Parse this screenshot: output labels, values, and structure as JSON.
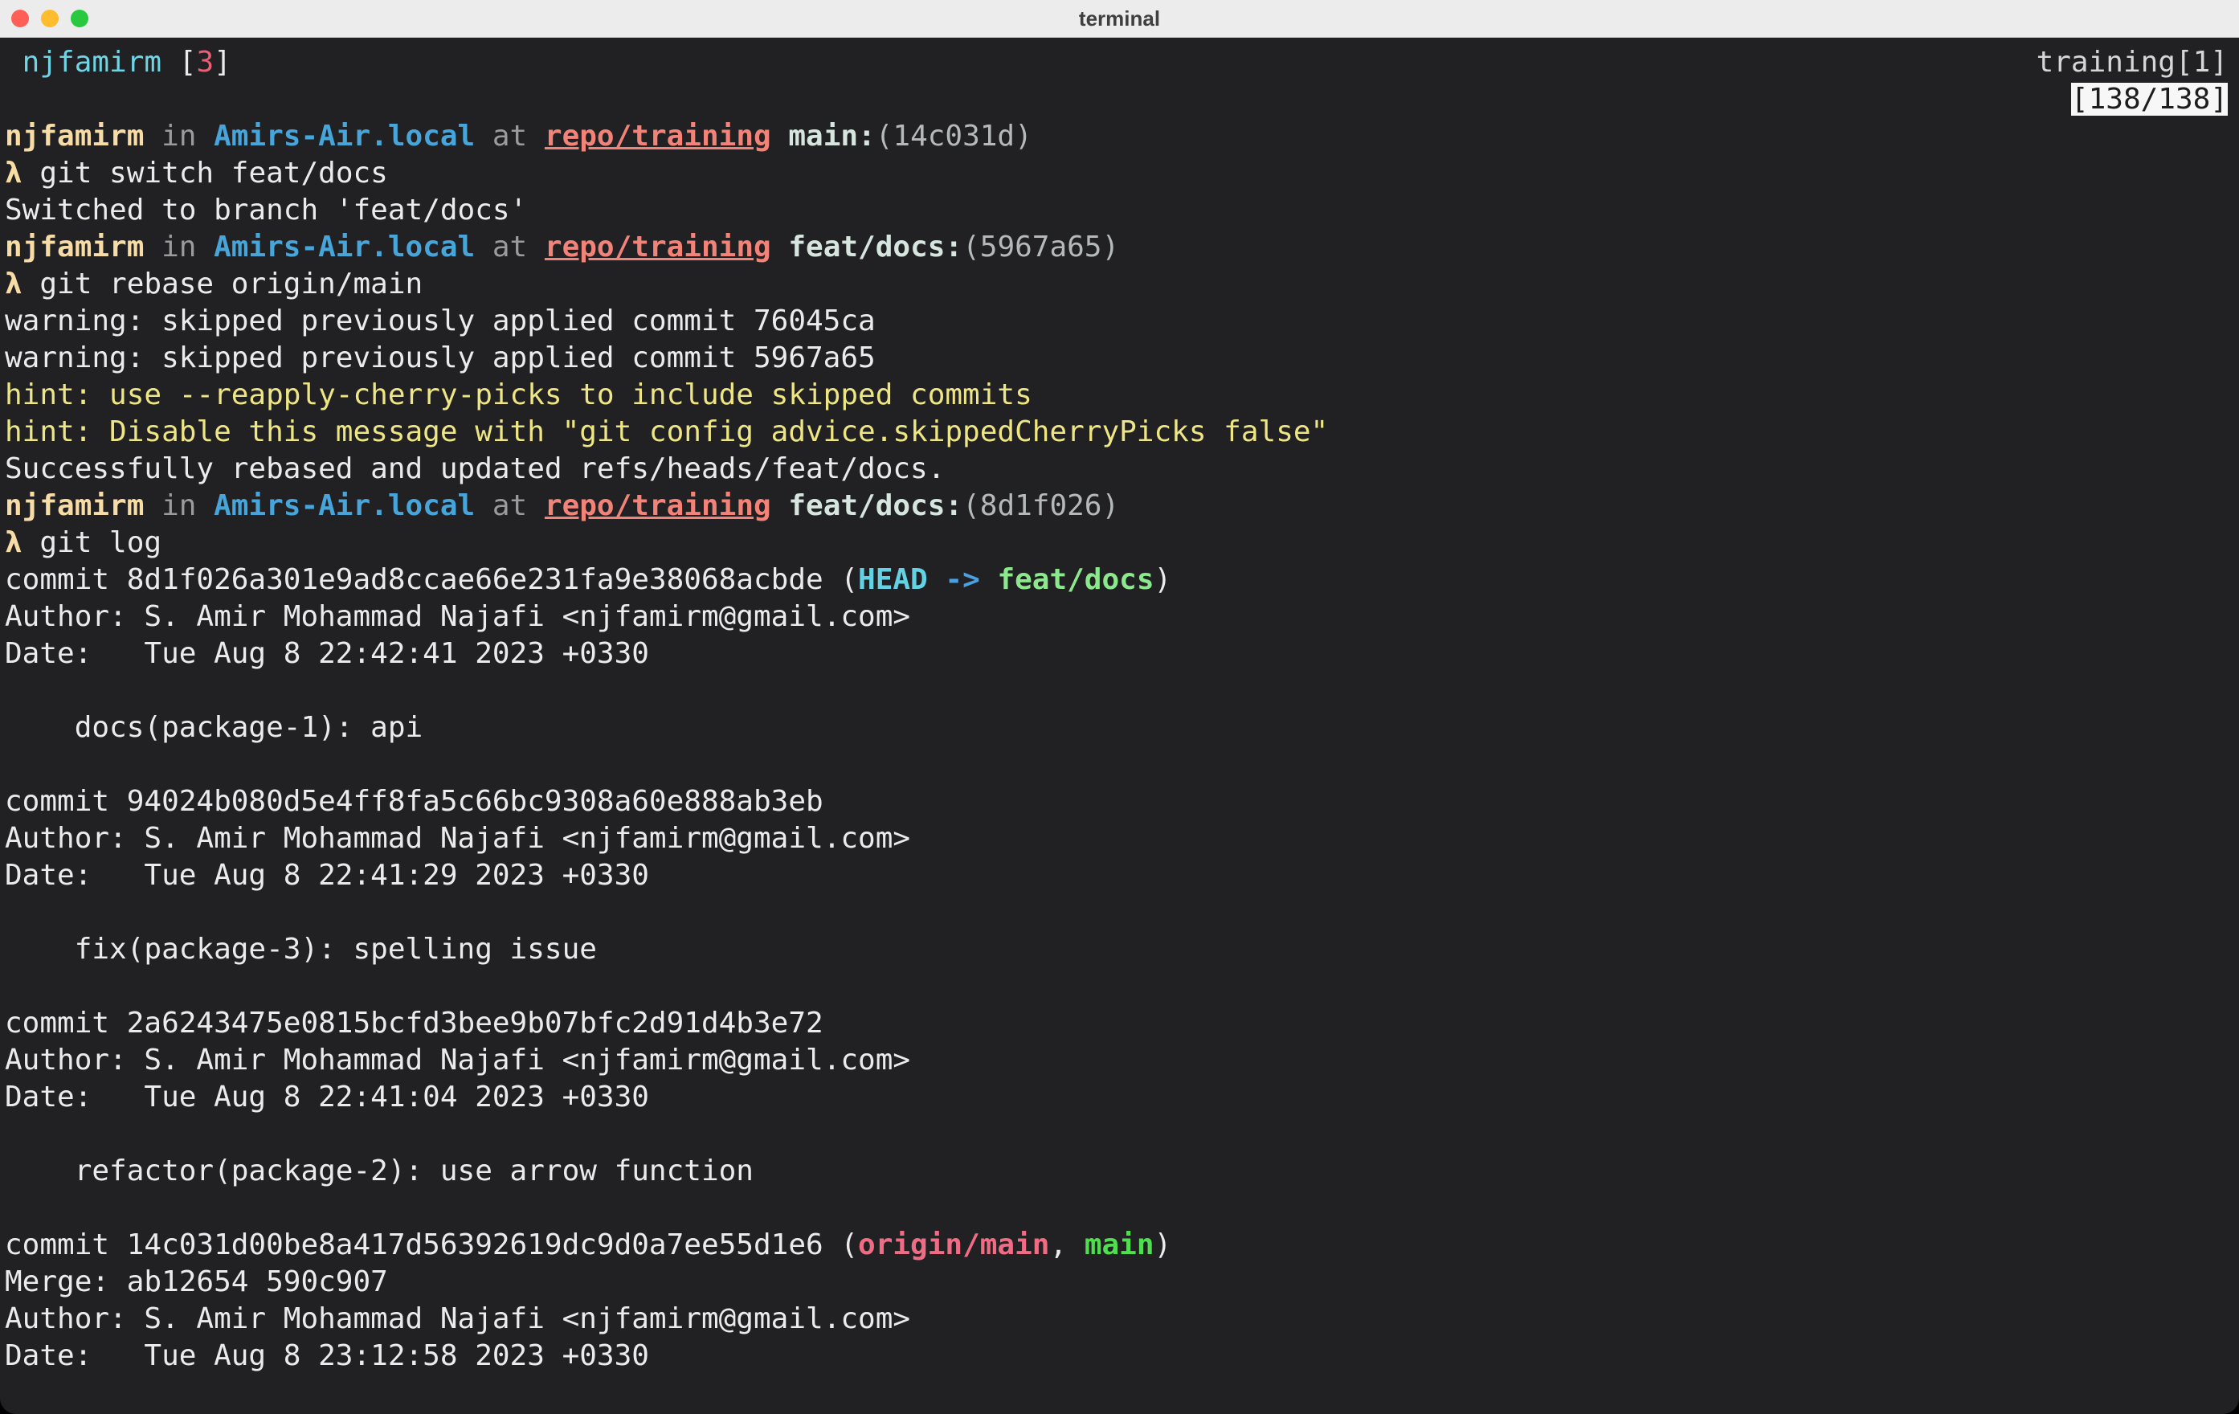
{
  "window": {
    "title": "terminal"
  },
  "colors": {
    "term_bg": "#212124",
    "titlebar_bg": "#ececec",
    "title_fg": "#3f3f3f",
    "traffic": [
      "#ff5f57",
      "#febc2e",
      "#28c840"
    ],
    "fg": "#ebebeb",
    "gray": "#9b9b9b",
    "cream": "#f7dca6",
    "blue": "#47a5da",
    "salmon": "#f28379",
    "pale": "#d6e5de",
    "hash": "#b5b9b9",
    "cyan": "#6fd4e4",
    "red": "#ea5e76",
    "ltgray": "#d6d6d6",
    "yellow": "#eee684",
    "cyan2": "#62d2e4",
    "blue2": "#4aa0e0",
    "green": "#8ce88c",
    "green2": "#50dd50",
    "pink": "#ee6d85",
    "counter_bg": "#f7f7f7",
    "counter_fg": "#1d1d1d"
  },
  "terminal": {
    "lines": [
      {
        "name": "tab-line",
        "segments": [
          {
            "t": " njfamirm ",
            "c": "cyan",
            "n": "tab-title"
          },
          {
            "t": "[",
            "c": "fg"
          },
          {
            "t": "3",
            "c": "red",
            "n": "tab-count"
          },
          {
            "t": "]",
            "c": "fg"
          }
        ],
        "right": [
          {
            "t": "training[1]",
            "c": "ltgray",
            "n": "session-name"
          }
        ]
      },
      {
        "name": "pane-counter-line",
        "segments": [],
        "right": [
          {
            "t": "[138/138]",
            "box": true,
            "n": "scroll-position-counter"
          }
        ]
      },
      {
        "name": "prompt-line",
        "segments": [
          {
            "t": "njfamirm",
            "c": "cream",
            "b": true,
            "n": "prompt-user"
          },
          {
            "t": " in ",
            "c": "gray"
          },
          {
            "t": "Amirs-Air.local",
            "c": "blue",
            "b": true,
            "n": "prompt-host"
          },
          {
            "t": " at ",
            "c": "gray"
          },
          {
            "t": "repo/training",
            "c": "salmon",
            "b": true,
            "u": true,
            "n": "prompt-path"
          },
          {
            "t": " main:",
            "c": "pale",
            "b": true,
            "n": "prompt-branch"
          },
          {
            "t": "(14c031d)",
            "c": "hash",
            "n": "prompt-commit"
          }
        ]
      },
      {
        "name": "command-line",
        "segments": [
          {
            "t": "λ",
            "c": "cream",
            "b": true,
            "n": "prompt-symbol"
          },
          {
            "t": " git switch feat/docs",
            "c": "fg"
          }
        ]
      },
      {
        "name": "output-line",
        "segments": [
          {
            "t": "Switched to branch 'feat/docs'",
            "c": "fg"
          }
        ]
      },
      {
        "name": "prompt-line",
        "segments": [
          {
            "t": "njfamirm",
            "c": "cream",
            "b": true,
            "n": "prompt-user"
          },
          {
            "t": " in ",
            "c": "gray"
          },
          {
            "t": "Amirs-Air.local",
            "c": "blue",
            "b": true,
            "n": "prompt-host"
          },
          {
            "t": " at ",
            "c": "gray"
          },
          {
            "t": "repo/training",
            "c": "salmon",
            "b": true,
            "u": true,
            "n": "prompt-path"
          },
          {
            "t": " feat/docs:",
            "c": "pale",
            "b": true,
            "n": "prompt-branch"
          },
          {
            "t": "(5967a65)",
            "c": "hash",
            "n": "prompt-commit"
          }
        ]
      },
      {
        "name": "command-line",
        "segments": [
          {
            "t": "λ",
            "c": "cream",
            "b": true,
            "n": "prompt-symbol"
          },
          {
            "t": " git rebase origin/main",
            "c": "fg"
          }
        ]
      },
      {
        "name": "output-line",
        "segments": [
          {
            "t": "warning: skipped previously applied commit 76045ca",
            "c": "fg"
          }
        ]
      },
      {
        "name": "output-line",
        "segments": [
          {
            "t": "warning: skipped previously applied commit 5967a65",
            "c": "fg"
          }
        ]
      },
      {
        "name": "hint-line",
        "segments": [
          {
            "t": "hint: use --reapply-cherry-picks to include skipped commits",
            "c": "yellow"
          }
        ]
      },
      {
        "name": "hint-line",
        "segments": [
          {
            "t": "hint: Disable this message with \"git config advice.skippedCherryPicks false\"",
            "c": "yellow"
          }
        ]
      },
      {
        "name": "output-line",
        "segments": [
          {
            "t": "Successfully rebased and updated refs/heads/feat/docs.",
            "c": "fg"
          }
        ]
      },
      {
        "name": "prompt-line",
        "segments": [
          {
            "t": "njfamirm",
            "c": "cream",
            "b": true,
            "n": "prompt-user"
          },
          {
            "t": " in ",
            "c": "gray"
          },
          {
            "t": "Amirs-Air.local",
            "c": "blue",
            "b": true,
            "n": "prompt-host"
          },
          {
            "t": " at ",
            "c": "gray"
          },
          {
            "t": "repo/training",
            "c": "salmon",
            "b": true,
            "u": true,
            "n": "prompt-path"
          },
          {
            "t": " feat/docs:",
            "c": "pale",
            "b": true,
            "n": "prompt-branch"
          },
          {
            "t": "(8d1f026)",
            "c": "hash",
            "n": "prompt-commit"
          }
        ]
      },
      {
        "name": "command-line",
        "segments": [
          {
            "t": "λ",
            "c": "cream",
            "b": true,
            "n": "prompt-symbol"
          },
          {
            "t": " git log",
            "c": "fg"
          }
        ]
      },
      {
        "name": "commit-header-line",
        "segments": [
          {
            "t": "commit 8d1f026a301e9ad8ccae66e231fa9e38068acbde (",
            "c": "fg"
          },
          {
            "t": "HEAD",
            "c": "cyan2",
            "b": true,
            "n": "ref-head"
          },
          {
            "t": " -> ",
            "c": "blue2",
            "b": true,
            "n": "ref-arrow"
          },
          {
            "t": "feat/docs",
            "c": "green",
            "b": true,
            "n": "ref-branch"
          },
          {
            "t": ")",
            "c": "fg"
          }
        ]
      },
      {
        "name": "author-line",
        "segments": [
          {
            "t": "Author: S. Amir Mohammad Najafi <njfamirm@gmail.com>",
            "c": "fg"
          }
        ]
      },
      {
        "name": "date-line",
        "segments": [
          {
            "t": "Date:   Tue Aug 8 22:42:41 2023 +0330",
            "c": "fg"
          }
        ]
      },
      {
        "name": "blank-line",
        "segments": []
      },
      {
        "name": "commit-message-line",
        "segments": [
          {
            "t": "    docs(package-1): api",
            "c": "fg"
          }
        ]
      },
      {
        "name": "blank-line",
        "segments": []
      },
      {
        "name": "commit-header-line",
        "segments": [
          {
            "t": "commit 94024b080d5e4ff8fa5c66bc9308a60e888ab3eb",
            "c": "fg"
          }
        ]
      },
      {
        "name": "author-line",
        "segments": [
          {
            "t": "Author: S. Amir Mohammad Najafi <njfamirm@gmail.com>",
            "c": "fg"
          }
        ]
      },
      {
        "name": "date-line",
        "segments": [
          {
            "t": "Date:   Tue Aug 8 22:41:29 2023 +0330",
            "c": "fg"
          }
        ]
      },
      {
        "name": "blank-line",
        "segments": []
      },
      {
        "name": "commit-message-line",
        "segments": [
          {
            "t": "    fix(package-3): spelling issue",
            "c": "fg"
          }
        ]
      },
      {
        "name": "blank-line",
        "segments": []
      },
      {
        "name": "commit-header-line",
        "segments": [
          {
            "t": "commit 2a6243475e0815bcfd3bee9b07bfc2d91d4b3e72",
            "c": "fg"
          }
        ]
      },
      {
        "name": "author-line",
        "segments": [
          {
            "t": "Author: S. Amir Mohammad Najafi <njfamirm@gmail.com>",
            "c": "fg"
          }
        ]
      },
      {
        "name": "date-line",
        "segments": [
          {
            "t": "Date:   Tue Aug 8 22:41:04 2023 +0330",
            "c": "fg"
          }
        ]
      },
      {
        "name": "blank-line",
        "segments": []
      },
      {
        "name": "commit-message-line",
        "segments": [
          {
            "t": "    refactor(package-2): use arrow function",
            "c": "fg"
          }
        ]
      },
      {
        "name": "blank-line",
        "segments": []
      },
      {
        "name": "commit-header-line",
        "segments": [
          {
            "t": "commit 14c031d00be8a417d56392619dc9d0a7ee55d1e6 (",
            "c": "fg"
          },
          {
            "t": "origin/main",
            "c": "pink",
            "b": true,
            "n": "ref-remote-branch"
          },
          {
            "t": ", ",
            "c": "fg"
          },
          {
            "t": "main",
            "c": "green2",
            "b": true,
            "n": "ref-branch"
          },
          {
            "t": ")",
            "c": "fg"
          }
        ]
      },
      {
        "name": "merge-line",
        "segments": [
          {
            "t": "Merge: ab12654 590c907",
            "c": "fg"
          }
        ]
      },
      {
        "name": "author-line",
        "segments": [
          {
            "t": "Author: S. Amir Mohammad Najafi <njfamirm@gmail.com>",
            "c": "fg"
          }
        ]
      },
      {
        "name": "date-line",
        "segments": [
          {
            "t": "Date:   Tue Aug 8 23:12:58 2023 +0330",
            "c": "fg"
          }
        ]
      }
    ]
  }
}
